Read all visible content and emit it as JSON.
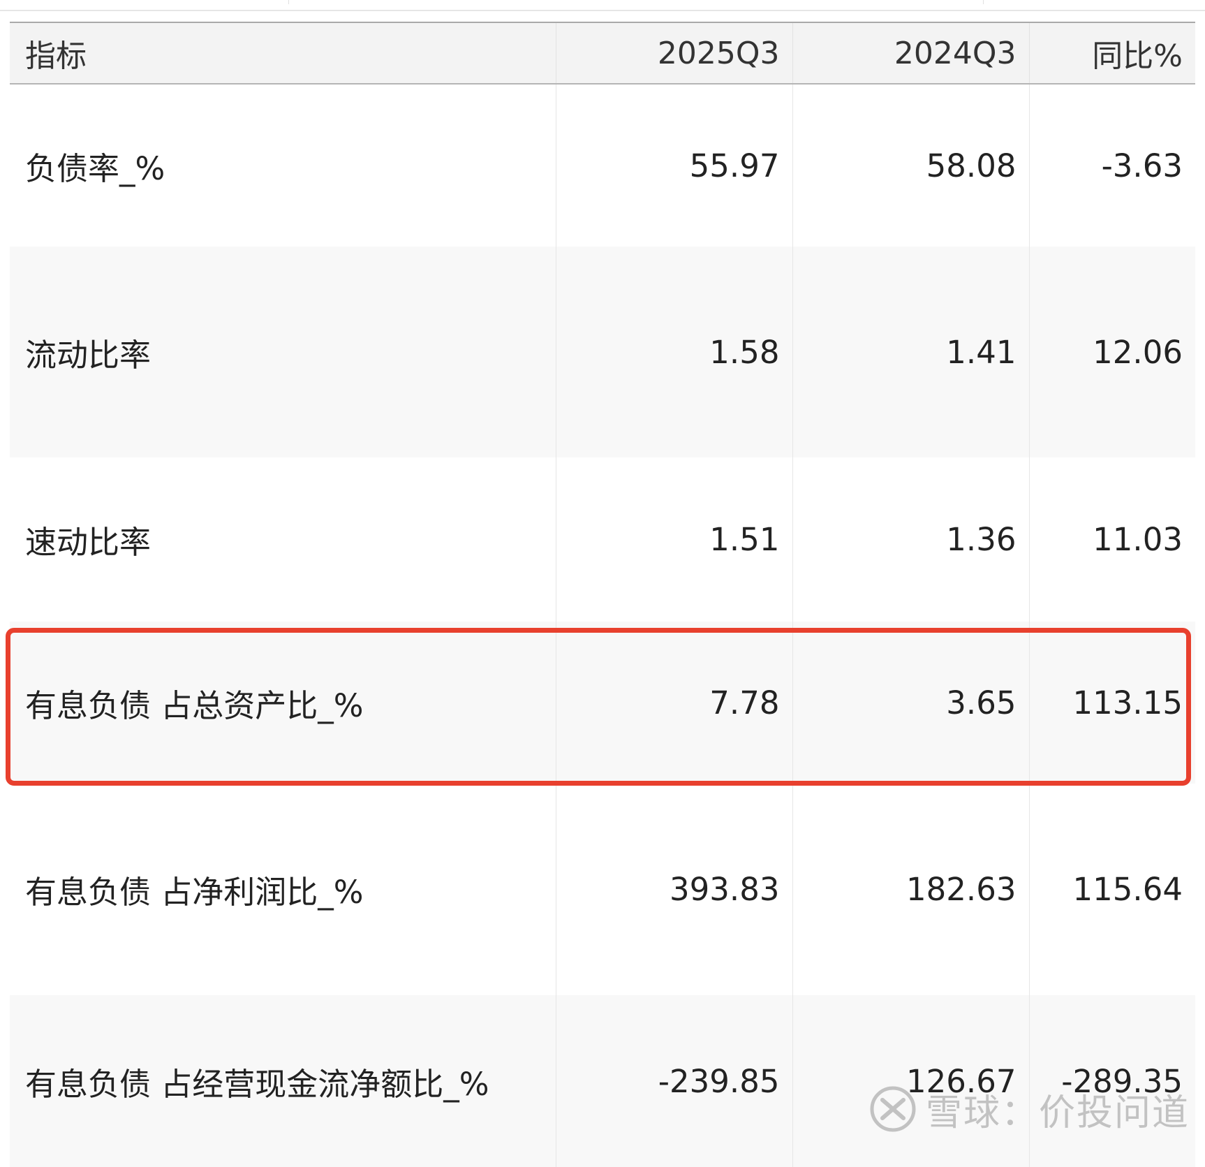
{
  "table": {
    "headers": [
      "指标",
      "2025Q3",
      "2024Q3",
      "同比%"
    ],
    "rows": [
      {
        "label": "负债率_%",
        "q3_2025": "55.97",
        "q3_2024": "58.08",
        "yoy": "-3.63"
      },
      {
        "label": "流动比率",
        "q3_2025": "1.58",
        "q3_2024": "1.41",
        "yoy": "12.06"
      },
      {
        "label": "速动比率",
        "q3_2025": "1.51",
        "q3_2024": "1.36",
        "yoy": "11.03"
      },
      {
        "label": "有息负债 占总资产比_%",
        "q3_2025": "7.78",
        "q3_2024": "3.65",
        "yoy": "113.15"
      },
      {
        "label": "有息负债 占净利润比_%",
        "q3_2025": "393.83",
        "q3_2024": "182.63",
        "yoy": "115.64"
      },
      {
        "label": "有息负债 占经营现金流净额比_%",
        "q3_2025": "-239.85",
        "q3_2024": "126.67",
        "yoy": "-289.35"
      }
    ],
    "highlighted_row": "有息负债 占总资产比_%",
    "highlight_color": "#e8402e"
  },
  "watermark": {
    "text": "雪球：价投问道",
    "icon": "xueqiu-logo-icon"
  }
}
